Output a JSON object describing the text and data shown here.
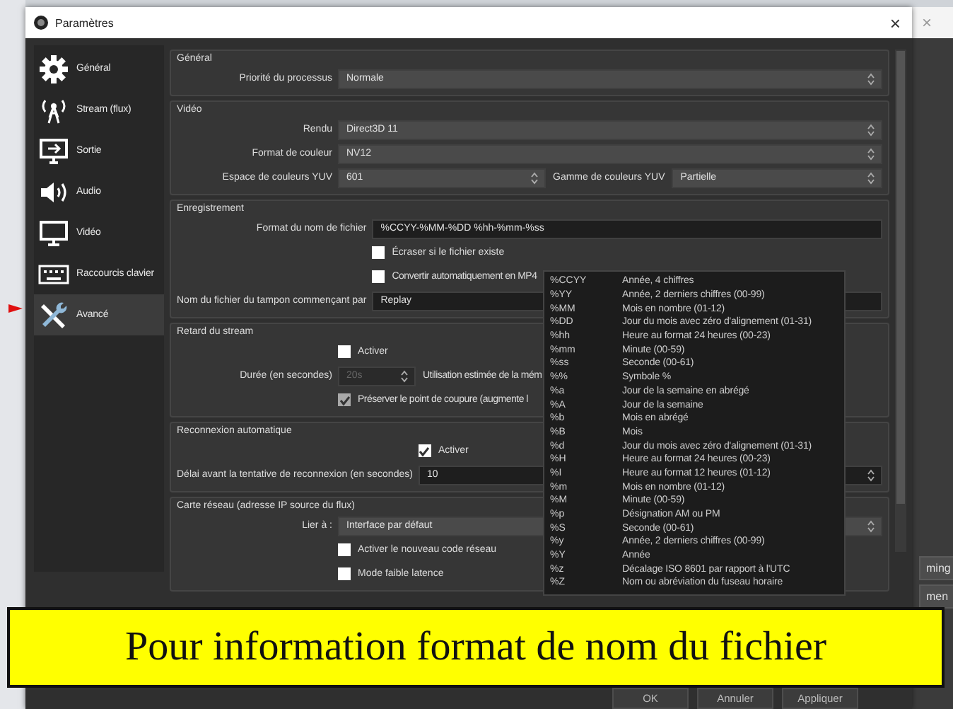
{
  "dialog": {
    "title": "Paramètres",
    "close": "×"
  },
  "background_window": {
    "close": "×",
    "buttons": [
      "ming",
      "men"
    ]
  },
  "sidebar": {
    "items": [
      {
        "label": "Général",
        "kind": "gear",
        "selected": false
      },
      {
        "label": "Stream (flux)",
        "kind": "antenna",
        "selected": false
      },
      {
        "label": "Sortie",
        "kind": "output",
        "selected": false
      },
      {
        "label": "Audio",
        "kind": "speaker",
        "selected": false
      },
      {
        "label": "Vidéo",
        "kind": "monitor",
        "selected": false
      },
      {
        "label": "Raccourcis clavier",
        "kind": "keyboard",
        "selected": false
      },
      {
        "label": "Avancé",
        "kind": "tools",
        "selected": true
      }
    ]
  },
  "sections": [
    {
      "title": "Général",
      "rows": [
        {
          "kind": "select",
          "label": "Priorité du processus",
          "value": "Normale"
        }
      ]
    },
    {
      "title": "Vidéo",
      "rows": [
        {
          "kind": "select",
          "label": "Rendu",
          "value": "Direct3D 11"
        },
        {
          "kind": "select",
          "label": "Format de couleur",
          "value": "NV12"
        },
        {
          "kind": "select_pair",
          "label": "Espace de couleurs YUV",
          "value": "601",
          "label_2": "Gamme de couleurs YUV",
          "value_2": "Partielle"
        }
      ]
    },
    {
      "title": "Enregistrement",
      "rows": [
        {
          "kind": "text",
          "label": "Format du nom de fichier",
          "value": "%CCYY-%MM-%DD %hh-%mm-%ss"
        },
        {
          "kind": "checkbox",
          "label": "Écraser si le fichier existe",
          "checked": false,
          "disabled": false
        },
        {
          "kind": "checkbox",
          "label": "Convertir automatiquement en MP4",
          "checked": false,
          "disabled": false
        },
        {
          "kind": "text",
          "label": "Nom du fichier du tampon commençant par",
          "value": "Replay"
        }
      ]
    },
    {
      "title": "Retard du stream",
      "rows": [
        {
          "kind": "checkbox",
          "label": "Activer",
          "checked": false,
          "disabled": false
        },
        {
          "kind": "spin",
          "label": "Durée (en secondes)",
          "value": "20s",
          "note": "Utilisation estimée de la mém",
          "disabled": true
        },
        {
          "kind": "checkbox",
          "label": "Préserver le point de coupure (augmente l",
          "checked": true,
          "disabled": true
        }
      ]
    },
    {
      "title": "Reconnexion automatique",
      "rows": [
        {
          "kind": "checkbox",
          "label": "Activer",
          "checked": true,
          "disabled": false
        },
        {
          "kind": "spin",
          "label": "Délai avant la tentative de reconnexion (en secondes)",
          "value": "10",
          "disabled": false
        }
      ]
    },
    {
      "title": "Carte réseau (adresse IP source du flux)",
      "rows": [
        {
          "kind": "select",
          "label": "Lier à :",
          "value": "Interface par défaut"
        },
        {
          "kind": "checkbox",
          "label": "Activer le nouveau code réseau",
          "checked": false,
          "disabled": false
        },
        {
          "kind": "checkbox",
          "label": "Mode faible latence",
          "checked": false,
          "disabled": false
        }
      ]
    }
  ],
  "format_popup": {
    "rows": [
      {
        "code": "%CCYY",
        "description": "Année, 4 chiffres"
      },
      {
        "code": "%YY",
        "description": "Année, 2 derniers chiffres (00-99)"
      },
      {
        "code": "%MM",
        "description": "Mois en nombre (01-12)"
      },
      {
        "code": "%DD",
        "description": "Jour du mois avec zéro d'alignement (01-31)"
      },
      {
        "code": "%hh",
        "description": "Heure au format 24 heures (00-23)"
      },
      {
        "code": "%mm",
        "description": "Minute (00-59)"
      },
      {
        "code": "%ss",
        "description": "Seconde (00-61)"
      },
      {
        "code": "%%",
        "description": "Symbole %"
      },
      {
        "code": "%a",
        "description": "Jour de la semaine en abrégé"
      },
      {
        "code": "%A",
        "description": "Jour de la semaine"
      },
      {
        "code": "%b",
        "description": "Mois en abrégé"
      },
      {
        "code": "%B",
        "description": "Mois"
      },
      {
        "code": "%d",
        "description": "Jour du mois avec zéro d'alignement (01-31)"
      },
      {
        "code": "%H",
        "description": "Heure au format 24 heures (00-23)"
      },
      {
        "code": "%I",
        "description": "Heure au format 12 heures (01-12)"
      },
      {
        "code": "%m",
        "description": "Mois en nombre (01-12)"
      },
      {
        "code": "%M",
        "description": "Minute (00-59)"
      },
      {
        "code": "%p",
        "description": "Désignation AM ou PM"
      },
      {
        "code": "%S",
        "description": "Seconde (00-61)"
      },
      {
        "code": "%y",
        "description": "Année, 2 derniers chiffres (00-99)"
      },
      {
        "code": "%Y",
        "description": "Année"
      },
      {
        "code": "%z",
        "description": "Décalage ISO 8601 par rapport à l'UTC"
      },
      {
        "code": "%Z",
        "description": "Nom ou abréviation du fuseau horaire"
      }
    ]
  },
  "buttons": [
    "OK",
    "Annuler",
    "Appliquer"
  ],
  "caption": "Pour information format de nom du fichier"
}
